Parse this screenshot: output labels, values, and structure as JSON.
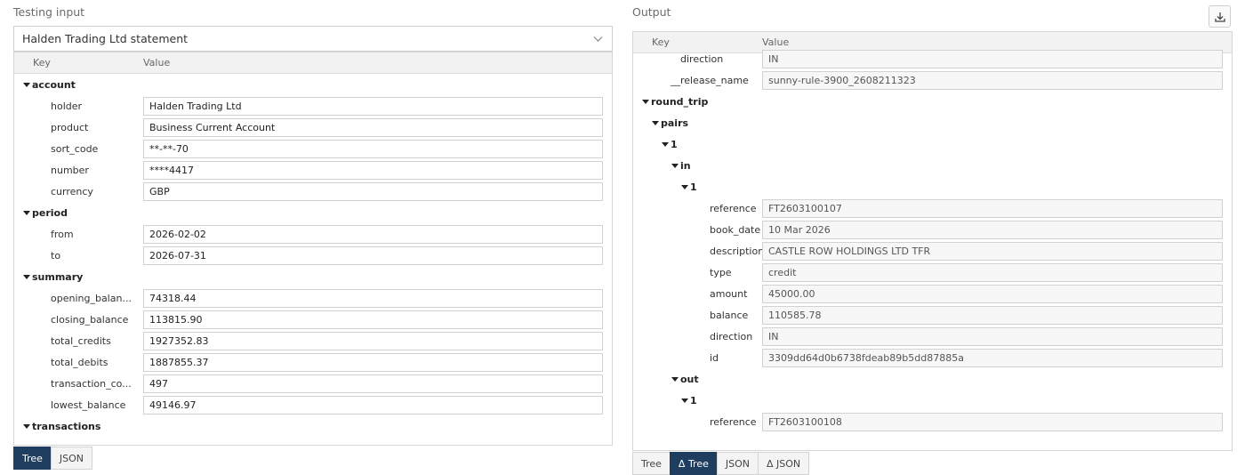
{
  "left": {
    "title": "Testing input",
    "selected_input": "Halden Trading Ltd statement",
    "columns": {
      "key": "Key",
      "value": "Value"
    },
    "tree": [
      {
        "key": "account",
        "group": true,
        "level": 0
      },
      {
        "key": "holder",
        "value": "Halden Trading Ltd",
        "level": 1
      },
      {
        "key": "product",
        "value": "Business Current Account",
        "level": 1
      },
      {
        "key": "sort_code",
        "value": "**-**-70",
        "level": 1
      },
      {
        "key": "number",
        "value": "****4417",
        "level": 1
      },
      {
        "key": "currency",
        "value": "GBP",
        "level": 1
      },
      {
        "key": "period",
        "group": true,
        "level": 0
      },
      {
        "key": "from",
        "value": "2026-02-02",
        "level": 1
      },
      {
        "key": "to",
        "value": "2026-07-31",
        "level": 1
      },
      {
        "key": "summary",
        "group": true,
        "level": 0
      },
      {
        "key": "opening_balan...",
        "value": "74318.44",
        "level": 1
      },
      {
        "key": "closing_balance",
        "value": "113815.90",
        "level": 1
      },
      {
        "key": "total_credits",
        "value": "1927352.83",
        "level": 1
      },
      {
        "key": "total_debits",
        "value": "1887855.37",
        "level": 1
      },
      {
        "key": "transaction_co...",
        "value": "497",
        "level": 1
      },
      {
        "key": "lowest_balance",
        "value": "49146.97",
        "level": 1
      },
      {
        "key": "transactions",
        "group": true,
        "level": 0
      }
    ],
    "tabs": [
      {
        "label": "Tree",
        "active": true
      },
      {
        "label": "JSON",
        "active": false
      }
    ]
  },
  "right": {
    "title": "Output",
    "download_icon": "download-icon",
    "columns": {
      "key": "Key",
      "value": "Value"
    },
    "tree": [
      {
        "key": "direction",
        "value": "IN",
        "level": 2
      },
      {
        "key": "__release_name",
        "value": "sunny-rule-3900_2608211323",
        "level": 1
      },
      {
        "key": "round_trip",
        "group": true,
        "level": 0
      },
      {
        "key": "pairs",
        "group": true,
        "level": 1
      },
      {
        "key": "1",
        "group": true,
        "level": 2
      },
      {
        "key": "in",
        "group": true,
        "level": 3
      },
      {
        "key": "1",
        "group": true,
        "level": 4
      },
      {
        "key": "reference",
        "value": "FT2603100107",
        "level": 5
      },
      {
        "key": "book_date",
        "value": "10 Mar 2026",
        "level": 5
      },
      {
        "key": "description",
        "value": "CASTLE ROW HOLDINGS LTD TFR",
        "level": 5
      },
      {
        "key": "type",
        "value": "credit",
        "level": 5
      },
      {
        "key": "amount",
        "value": "45000.00",
        "level": 5
      },
      {
        "key": "balance",
        "value": "110585.78",
        "level": 5
      },
      {
        "key": "direction",
        "value": "IN",
        "level": 5
      },
      {
        "key": "id",
        "value": "3309dd64d0b6738fdeab89b5dd87885a",
        "level": 5
      },
      {
        "key": "out",
        "group": true,
        "level": 3
      },
      {
        "key": "1",
        "group": true,
        "level": 4
      },
      {
        "key": "reference",
        "value": "FT2603100108",
        "level": 5
      }
    ],
    "tabs": [
      {
        "label": "Tree",
        "active": false
      },
      {
        "label": "Δ Tree",
        "active": true
      },
      {
        "label": "JSON",
        "active": false
      },
      {
        "label": "Δ JSON",
        "active": false
      }
    ]
  }
}
